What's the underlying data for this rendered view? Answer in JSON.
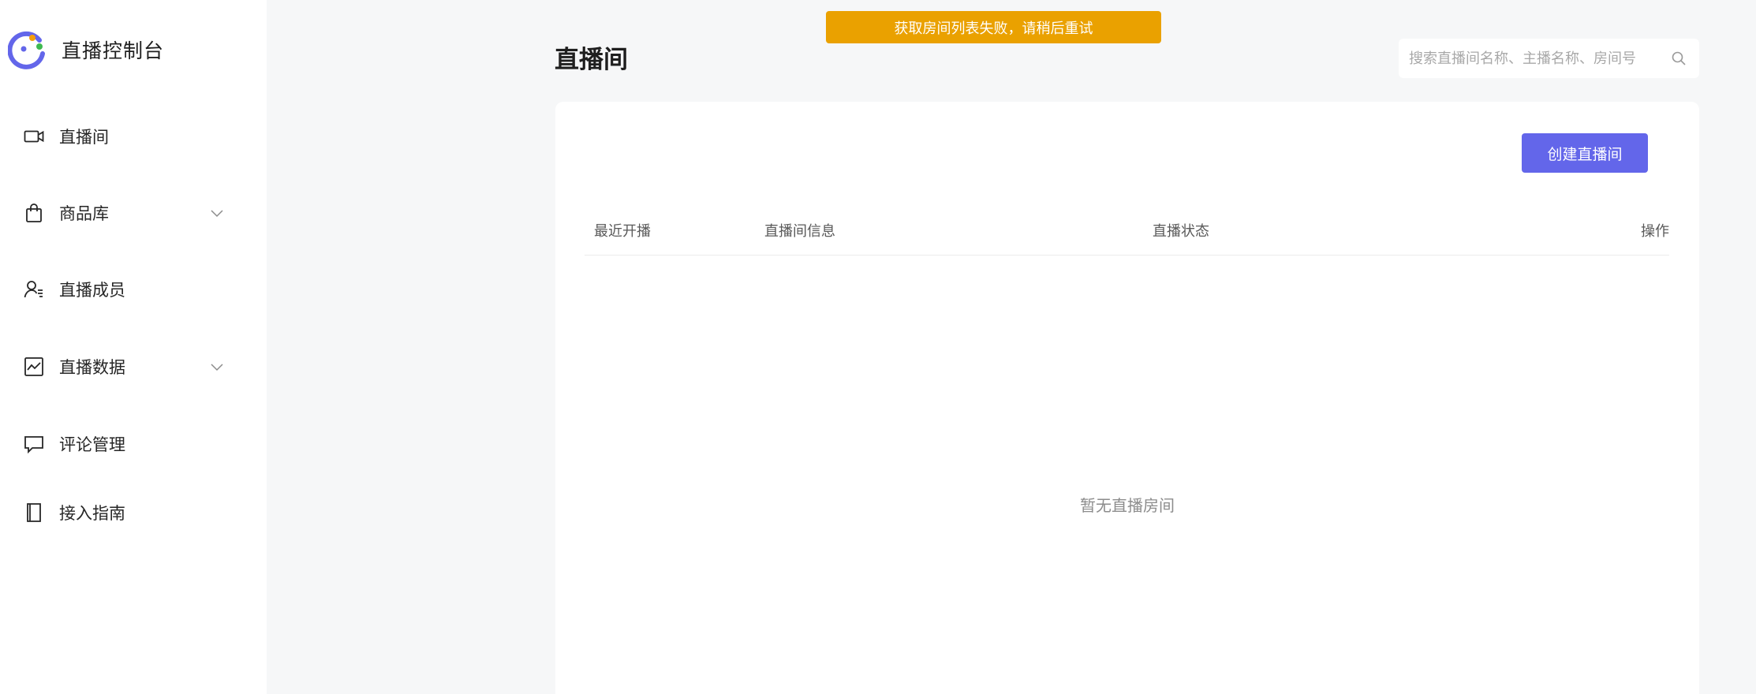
{
  "app": {
    "title": "直播控制台",
    "brand_colors": {
      "primary": "#6366ea",
      "accent_green": "#3fb950",
      "accent_orange": "#f59e0b"
    }
  },
  "sidebar": {
    "items": [
      {
        "label": "直播间",
        "icon": "video-camera-icon",
        "has_submenu": false
      },
      {
        "label": "商品库",
        "icon": "shopping-bag-icon",
        "has_submenu": true
      },
      {
        "label": "直播成员",
        "icon": "user-list-icon",
        "has_submenu": false
      },
      {
        "label": "直播数据",
        "icon": "chart-icon",
        "has_submenu": true
      },
      {
        "label": "评论管理",
        "icon": "comment-icon",
        "has_submenu": false
      },
      {
        "label": "接入指南",
        "icon": "book-icon",
        "has_submenu": false
      }
    ]
  },
  "header": {
    "page_title": "直播间",
    "search": {
      "placeholder": "搜索直播间名称、主播名称、房间号",
      "value": ""
    }
  },
  "toast": {
    "message": "获取房间列表失败，请稍后重试",
    "color": "#eaa100"
  },
  "main": {
    "create_button_label": "创建直播间",
    "table": {
      "columns": [
        "最近开播",
        "直播间信息",
        "直播状态",
        "操作"
      ],
      "rows": []
    },
    "empty_text": "暂无直播房间"
  }
}
